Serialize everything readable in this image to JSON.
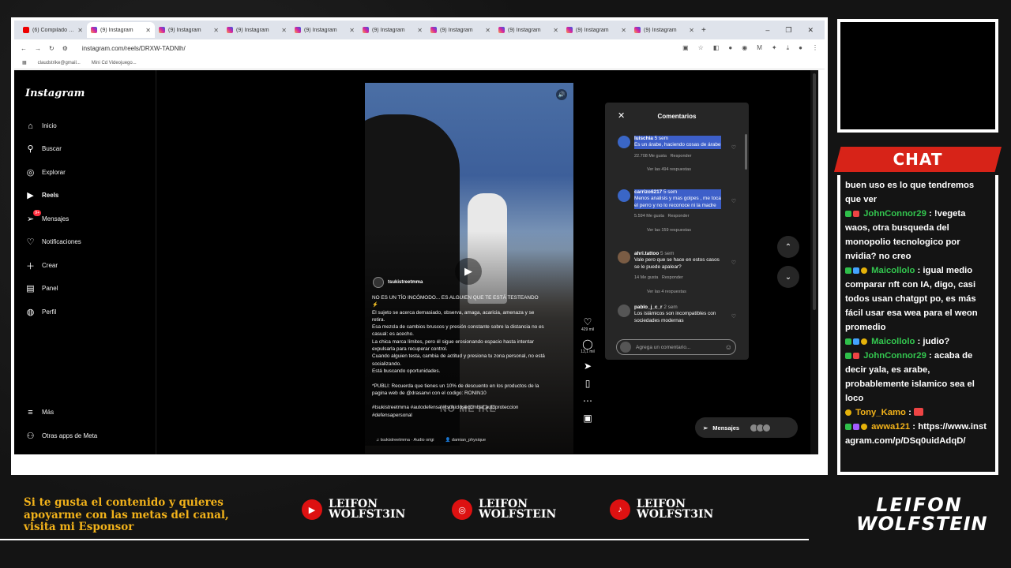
{
  "browser": {
    "tabs": [
      {
        "label": "(6) Compilado M...",
        "icon": "youtube-icon"
      },
      {
        "label": "(9) Instagram",
        "icon": "instagram-icon",
        "active": true
      },
      {
        "label": "(9) Instagram",
        "icon": "instagram-icon"
      },
      {
        "label": "(9) Instagram",
        "icon": "instagram-icon"
      },
      {
        "label": "(9) Instagram",
        "icon": "instagram-icon"
      },
      {
        "label": "(9) Instagram",
        "icon": "instagram-icon"
      },
      {
        "label": "(9) Instagram",
        "icon": "instagram-icon"
      },
      {
        "label": "(9) Instagram",
        "icon": "instagram-icon"
      },
      {
        "label": "(9) Instagram",
        "icon": "instagram-icon"
      },
      {
        "label": "(9) Instagram",
        "icon": "instagram-icon"
      }
    ],
    "url": "instagram.com/reels/DRXW-TADNlh/",
    "bookmarks": [
      "claudstrike@gmail...",
      "Mini Cd Videojuego..."
    ]
  },
  "instagram": {
    "logo": "Instagram",
    "nav": [
      {
        "label": "Inicio",
        "icon": "home-icon"
      },
      {
        "label": "Buscar",
        "icon": "search-icon"
      },
      {
        "label": "Explorar",
        "icon": "compass-icon"
      },
      {
        "label": "Reels",
        "icon": "reels-icon",
        "bold": true
      },
      {
        "label": "Mensajes",
        "icon": "messages-icon",
        "badge": "9+"
      },
      {
        "label": "Notificaciones",
        "icon": "heart-icon"
      },
      {
        "label": "Crear",
        "icon": "plus-icon"
      },
      {
        "label": "Panel",
        "icon": "panel-icon"
      },
      {
        "label": "Perfil",
        "icon": "avatar-icon"
      }
    ],
    "nav_bottom": [
      {
        "label": "Más",
        "icon": "menu-icon"
      },
      {
        "label": "Otras apps de Meta",
        "icon": "meta-apps-icon"
      }
    ],
    "reel": {
      "author": "tsukistreetmma",
      "caption": "NO ES UN TÍO INCÓMODO... ES ALGUIEN QUE TE ESTÁ TESTEANDO ⚡\nEl sujeto se acerca demasiado, observa, amaga, acaricia, amenaza y se retira.\nEsa mezcla de cambios bruscos y presión constante sobre la distancia no es casual: es acecho.\nLa chica marca límites, pero él sigue erosionando espacio hasta intentar expulsarla para recuperar control.\nCuando alguien testa, cambia de actitud y presiona tu zona personal, no está socializando.\nEstá buscando oportunidades.\n\n*PUBLI: Recuerda que tienes un 10% de descuento en los productos de la pagina web de @drasanvi con el codigo: RONIN10\n\n#tsukistreetmma #autodefensa #tsukiclosecombat autoproteccion #defensapersonal",
      "watermark": "NO ME IRE",
      "audio": "tsukistreetmma · Audio origi",
      "collab": "damian_physique"
    },
    "actions": {
      "likes": "429 mil",
      "comments": "13,1 mil"
    },
    "comments_panel": {
      "title": "Comentarios",
      "items": [
        {
          "user": "luischia",
          "time": "5 sem",
          "text": "Es un árabe, haciendo cosas de árabe",
          "likes": "22.708 Me gusta",
          "reply": "Responder",
          "more": "Ver las 494 respuestas"
        },
        {
          "user": "carrizo6217",
          "time": "5 sem",
          "text": "Menos analisis y mas golpes , me toca el perro y no lo reconoce ni la madre",
          "likes": "5.594 Me gusta",
          "reply": "Responder",
          "more": "Ver las 159 respuestas"
        },
        {
          "user": "ahri.tattoo",
          "time": "5 sem",
          "text": "Vale pero que se hace en estos casos se le puede apalear?",
          "likes": "14 Me gusta",
          "reply": "Responder",
          "more": "Ver las 4 respuestas"
        },
        {
          "user": "pablo_j_c_r",
          "time": "2 sem",
          "text": "Los islámicos son incompatibles con sociedades modernas",
          "likes": "",
          "reply": "",
          "more": ""
        }
      ],
      "input_placeholder": "Agrega un comentario..."
    },
    "messages_pill": {
      "label": "Mensajes",
      "badge": "9+"
    }
  },
  "chat": {
    "title": "CHAT",
    "messages": [
      {
        "user": "",
        "text": "buen uso es lo que tendremos que ver"
      },
      {
        "user": "JohnConnor29",
        "text": "!vegeta waos, otra busqueda del monopolio tecnologico por nvidia? no creo"
      },
      {
        "user": "Maicollolo",
        "text": "igual medio comparar nft con IA, digo, casi todos usan chatgpt po, es más fácil usar esa wea para el weon promedio"
      },
      {
        "user": "Maicollolo",
        "text": "judio?"
      },
      {
        "user": "JohnConnor29",
        "text": "acaba de decir yala, es arabe, probablemente islamico sea el loco"
      },
      {
        "user": "Tony_Kamo",
        "text": ""
      },
      {
        "user": "awwa121",
        "text": "https://www.instagram.com/p/DSq0uidAdqD/"
      }
    ]
  },
  "footer": {
    "sponsor_text": "Si te gusta el contenido y quieres apoyarme con las metas del canal, visita mi Esponsor",
    "socials": [
      {
        "icon": "youtube-icon",
        "name": "LEIFON WOLFST3IN",
        "line1": "LEIFON",
        "line2": "WOLFST3IN"
      },
      {
        "icon": "instagram-icon",
        "name": "LEIFON WOLFSTEIN",
        "line1": "LEIFON",
        "line2": "WOLFSTEIN"
      },
      {
        "icon": "tiktok-icon",
        "name": "LEIFON WOLFST3IN",
        "line1": "LEIFON",
        "line2": "WOLFST3IN"
      }
    ],
    "logo_line1": "LEIFON",
    "logo_line2": "WOLFSTEIN"
  },
  "colors": {
    "accent_red": "#d72318",
    "gold": "#f2b21a",
    "chat_user": "#33c64f",
    "highlight": "#3d5fc9"
  }
}
